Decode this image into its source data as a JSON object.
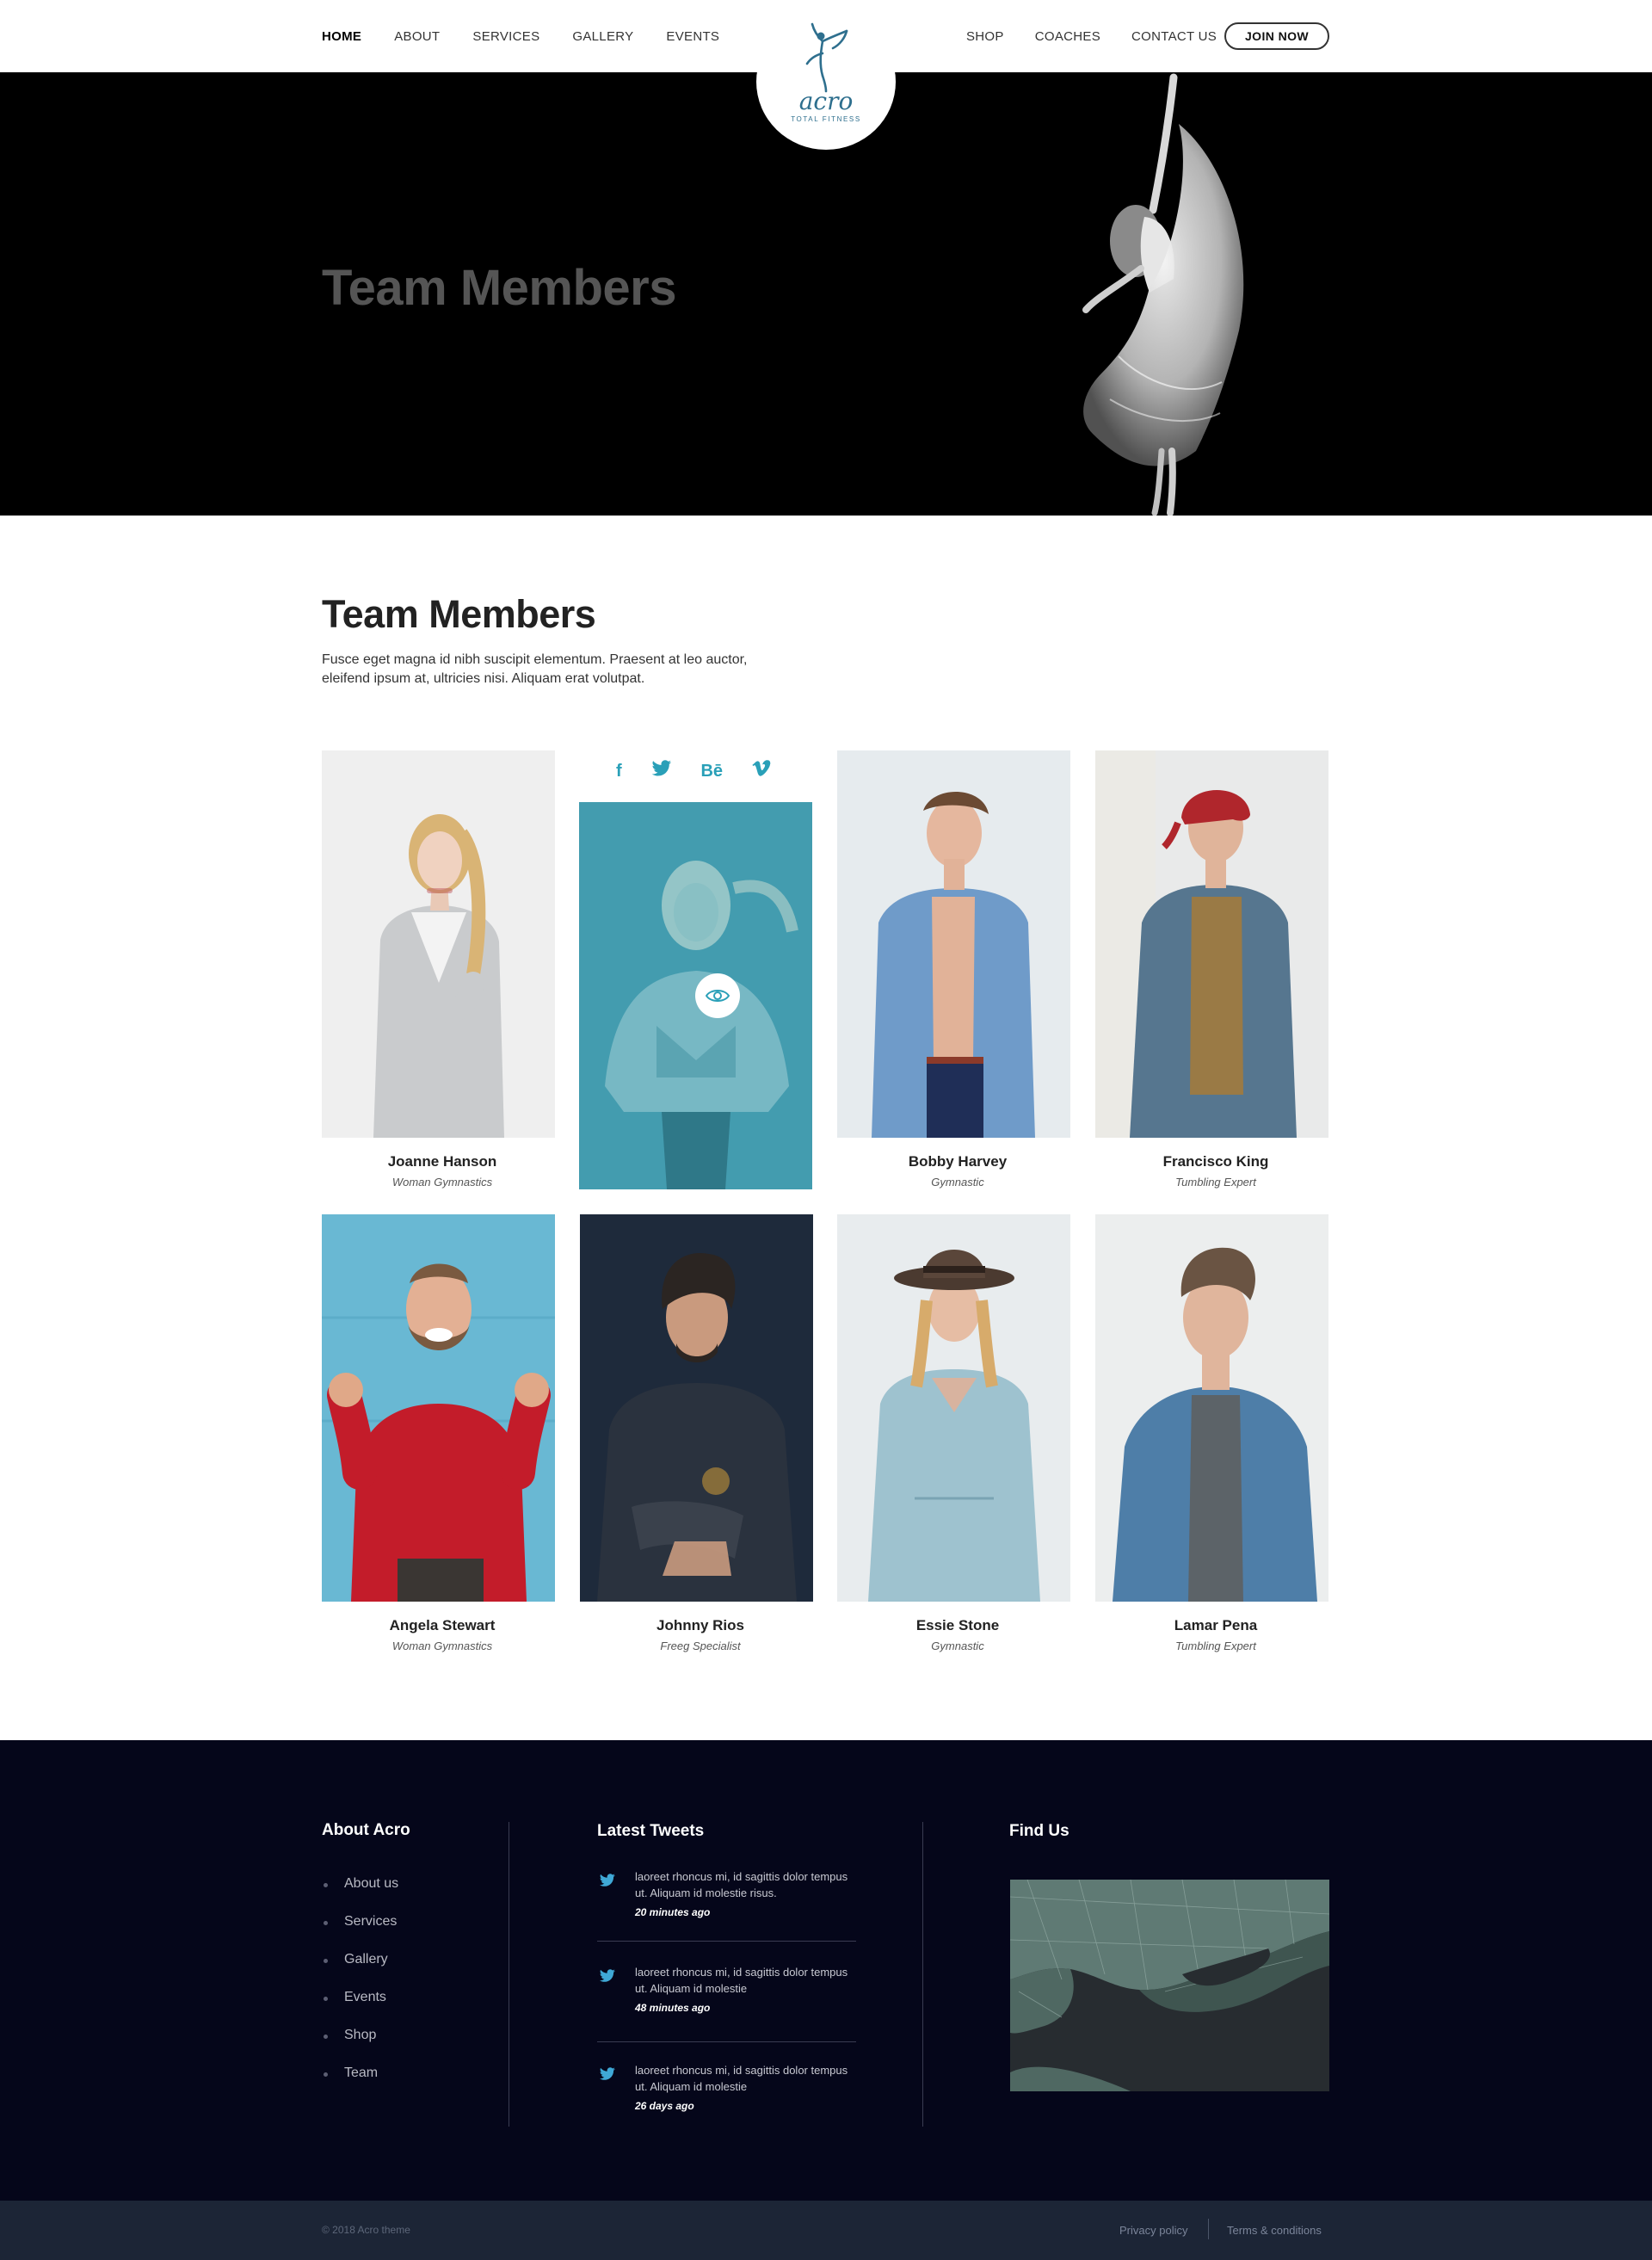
{
  "nav": {
    "left": [
      "HOME",
      "ABOUT",
      "SERVICES",
      "GALLERY",
      "EVENTS"
    ],
    "right": [
      "SHOP",
      "COACHES",
      "CONTACT US"
    ],
    "join": "JOIN NOW"
  },
  "logo": {
    "name": "acro",
    "tagline": "TOTAL FITNESS"
  },
  "hero": {
    "title": "Team Members"
  },
  "team": {
    "title": "Team Members",
    "description": "Fusce eget magna id nibh suscipit elementum. Praesent at leo auctor, eleifend ipsum at, ultricies nisi. Aliquam erat volutpat.",
    "social": [
      "f",
      "twitter-icon",
      "Bē",
      "vimeo-icon"
    ],
    "members": [
      {
        "name": "Joanne Hanson",
        "role": "Woman Gymnastics"
      },
      {
        "name": "",
        "role": ""
      },
      {
        "name": "Bobby Harvey",
        "role": "Gymnastic"
      },
      {
        "name": "Francisco King",
        "role": "Tumbling Expert"
      },
      {
        "name": "Angela Stewart",
        "role": "Woman Gymnastics"
      },
      {
        "name": "Johnny Rios",
        "role": "Freeg Specialist"
      },
      {
        "name": "Essie Stone",
        "role": "Gymnastic"
      },
      {
        "name": "Lamar Pena",
        "role": "Tumbling Expert"
      }
    ]
  },
  "footer": {
    "about_title": "About Acro",
    "about_links": [
      "About us",
      "Services",
      "Gallery",
      "Events",
      "Shop",
      "Team"
    ],
    "tweets_title": "Latest Tweets",
    "tweets": [
      {
        "text": "laoreet rhoncus mi, id sagittis dolor tempus ut. Aliquam id molestie risus.",
        "time": "20 minutes ago"
      },
      {
        "text": "laoreet rhoncus mi, id sagittis dolor tempus ut. Aliquam id molestie",
        "time": "48 minutes ago"
      },
      {
        "text": "laoreet rhoncus mi, id sagittis dolor tempus ut. Aliquam id molestie",
        "time": "26 days ago"
      }
    ],
    "find_title": "Find Us",
    "copyright": "© 2018 Acro theme",
    "privacy": "Privacy policy",
    "terms": "Terms & conditions"
  },
  "colors": {
    "accent": "#2aa0b8",
    "footer_bg": "#05061a",
    "bottom_bar": "#1c2536",
    "logo": "#2e6f8e"
  }
}
